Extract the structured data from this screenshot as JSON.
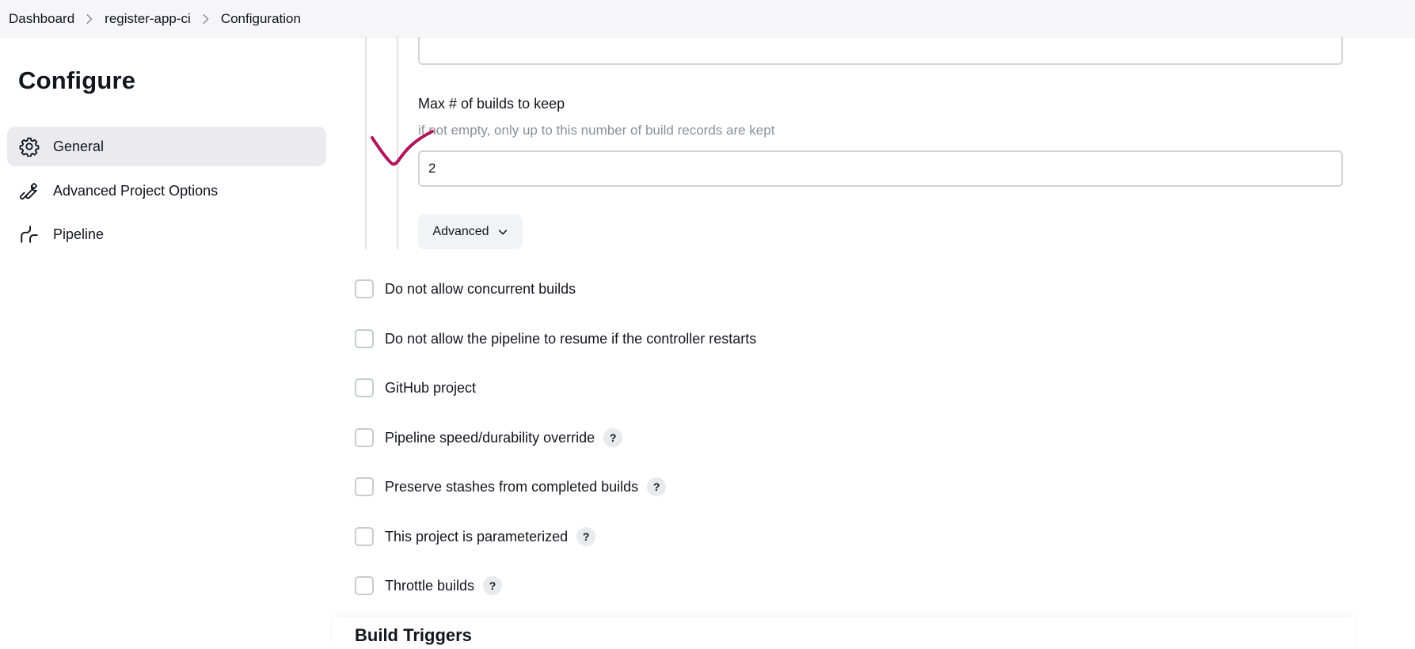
{
  "breadcrumb": {
    "items": [
      "Dashboard",
      "register-app-ci",
      "Configuration"
    ]
  },
  "sidebar": {
    "title": "Configure",
    "items": [
      {
        "label": "General",
        "icon": "gear-icon",
        "active": true
      },
      {
        "label": "Advanced Project Options",
        "icon": "wrench-icon",
        "active": false
      },
      {
        "label": "Pipeline",
        "icon": "pipeline-icon",
        "active": false
      }
    ]
  },
  "main": {
    "max_builds": {
      "label": "Max # of builds to keep",
      "description": "if not empty, only up to this number of build records are kept",
      "value": "2"
    },
    "advanced_button": "Advanced",
    "options": [
      {
        "label": "Do not allow concurrent builds",
        "checked": false,
        "help": false
      },
      {
        "label": "Do not allow the pipeline to resume if the controller restarts",
        "checked": false,
        "help": false
      },
      {
        "label": "GitHub project",
        "checked": false,
        "help": false
      },
      {
        "label": "Pipeline speed/durability override",
        "checked": false,
        "help": true
      },
      {
        "label": "Preserve stashes from completed builds",
        "checked": false,
        "help": true
      },
      {
        "label": "This project is parameterized",
        "checked": false,
        "help": true
      },
      {
        "label": "Throttle builds",
        "checked": false,
        "help": true
      }
    ],
    "help_glyph": "?",
    "next_section": "Build Triggers"
  },
  "colors": {
    "annotation": "#b0145e",
    "active_bg": "#ebebef",
    "border": "#cfd5d9"
  }
}
